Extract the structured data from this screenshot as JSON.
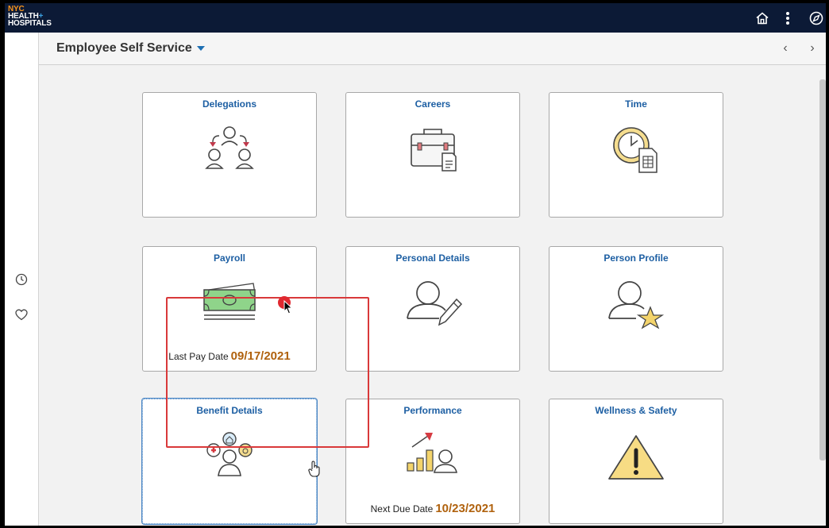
{
  "brand": {
    "line1": "NYC",
    "line2": "HEALTH",
    "plus": "+",
    "line3": "HOSPITALS"
  },
  "topbar": {
    "icons": [
      "home-icon",
      "more-vertical-icon",
      "navbar-compass-icon"
    ]
  },
  "left_rail": {
    "icons": [
      "recent-clock-icon",
      "favorites-heart-icon"
    ]
  },
  "header": {
    "title": "Employee Self Service",
    "prev_label": "‹",
    "next_label": "›"
  },
  "tiles": [
    {
      "title": "Delegations",
      "icon": "delegations-icon"
    },
    {
      "title": "Careers",
      "icon": "briefcase-document-icon"
    },
    {
      "title": "Time",
      "icon": "clock-timesheet-icon"
    },
    {
      "title": "Payroll",
      "icon": "money-cash-icon",
      "footer_label": "Last Pay Date",
      "footer_value": "09/17/2021"
    },
    {
      "title": "Personal Details",
      "icon": "person-edit-icon"
    },
    {
      "title": "Person Profile",
      "icon": "person-star-icon"
    },
    {
      "title": "Benefit Details",
      "icon": "benefits-person-icon"
    },
    {
      "title": "Performance",
      "icon": "performance-chart-icon",
      "footer_label": "Next Due Date",
      "footer_value": "10/23/2021"
    },
    {
      "title": "Wellness & Safety",
      "icon": "warning-triangle-icon"
    }
  ],
  "colors": {
    "topbar": "#0c1a36",
    "tile_title": "#1d5fa3",
    "footer_value": "#b0620e",
    "highlight": "#d9393a"
  }
}
